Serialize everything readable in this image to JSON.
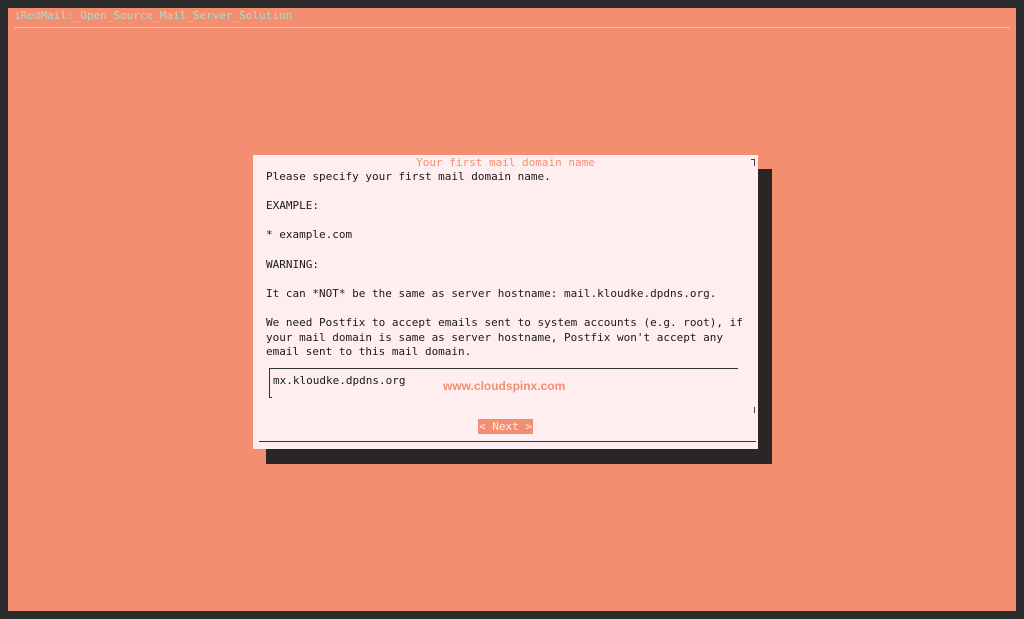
{
  "window": {
    "backtitle": "iRedMail:_Open_Source_Mail_Server_Solution"
  },
  "dialog": {
    "title": "Your first mail domain name",
    "lines": [
      "Please specify your first mail domain name.",
      "",
      "EXAMPLE:",
      "",
      "* example.com",
      "",
      "WARNING:",
      "",
      "It can *NOT* be the same as server hostname: mail.kloudke.dpdns.org.",
      "",
      "We need Postfix to accept emails sent to system accounts (e.g. root), if",
      "your mail domain is same as server hostname, Postfix won't accept any",
      "email sent to this mail domain."
    ],
    "input_value": "mx.kloudke.dpdns.org",
    "watermark": "www.cloudspinx.com",
    "next_button": {
      "prefix": "< ",
      "hotkey": "N",
      "rest": "ext",
      "suffix": " >"
    }
  },
  "colors": {
    "background": "#f48e71",
    "dialog": "#feeeef",
    "shadow": "#2a2625",
    "backtitle": "#a9dccf"
  }
}
